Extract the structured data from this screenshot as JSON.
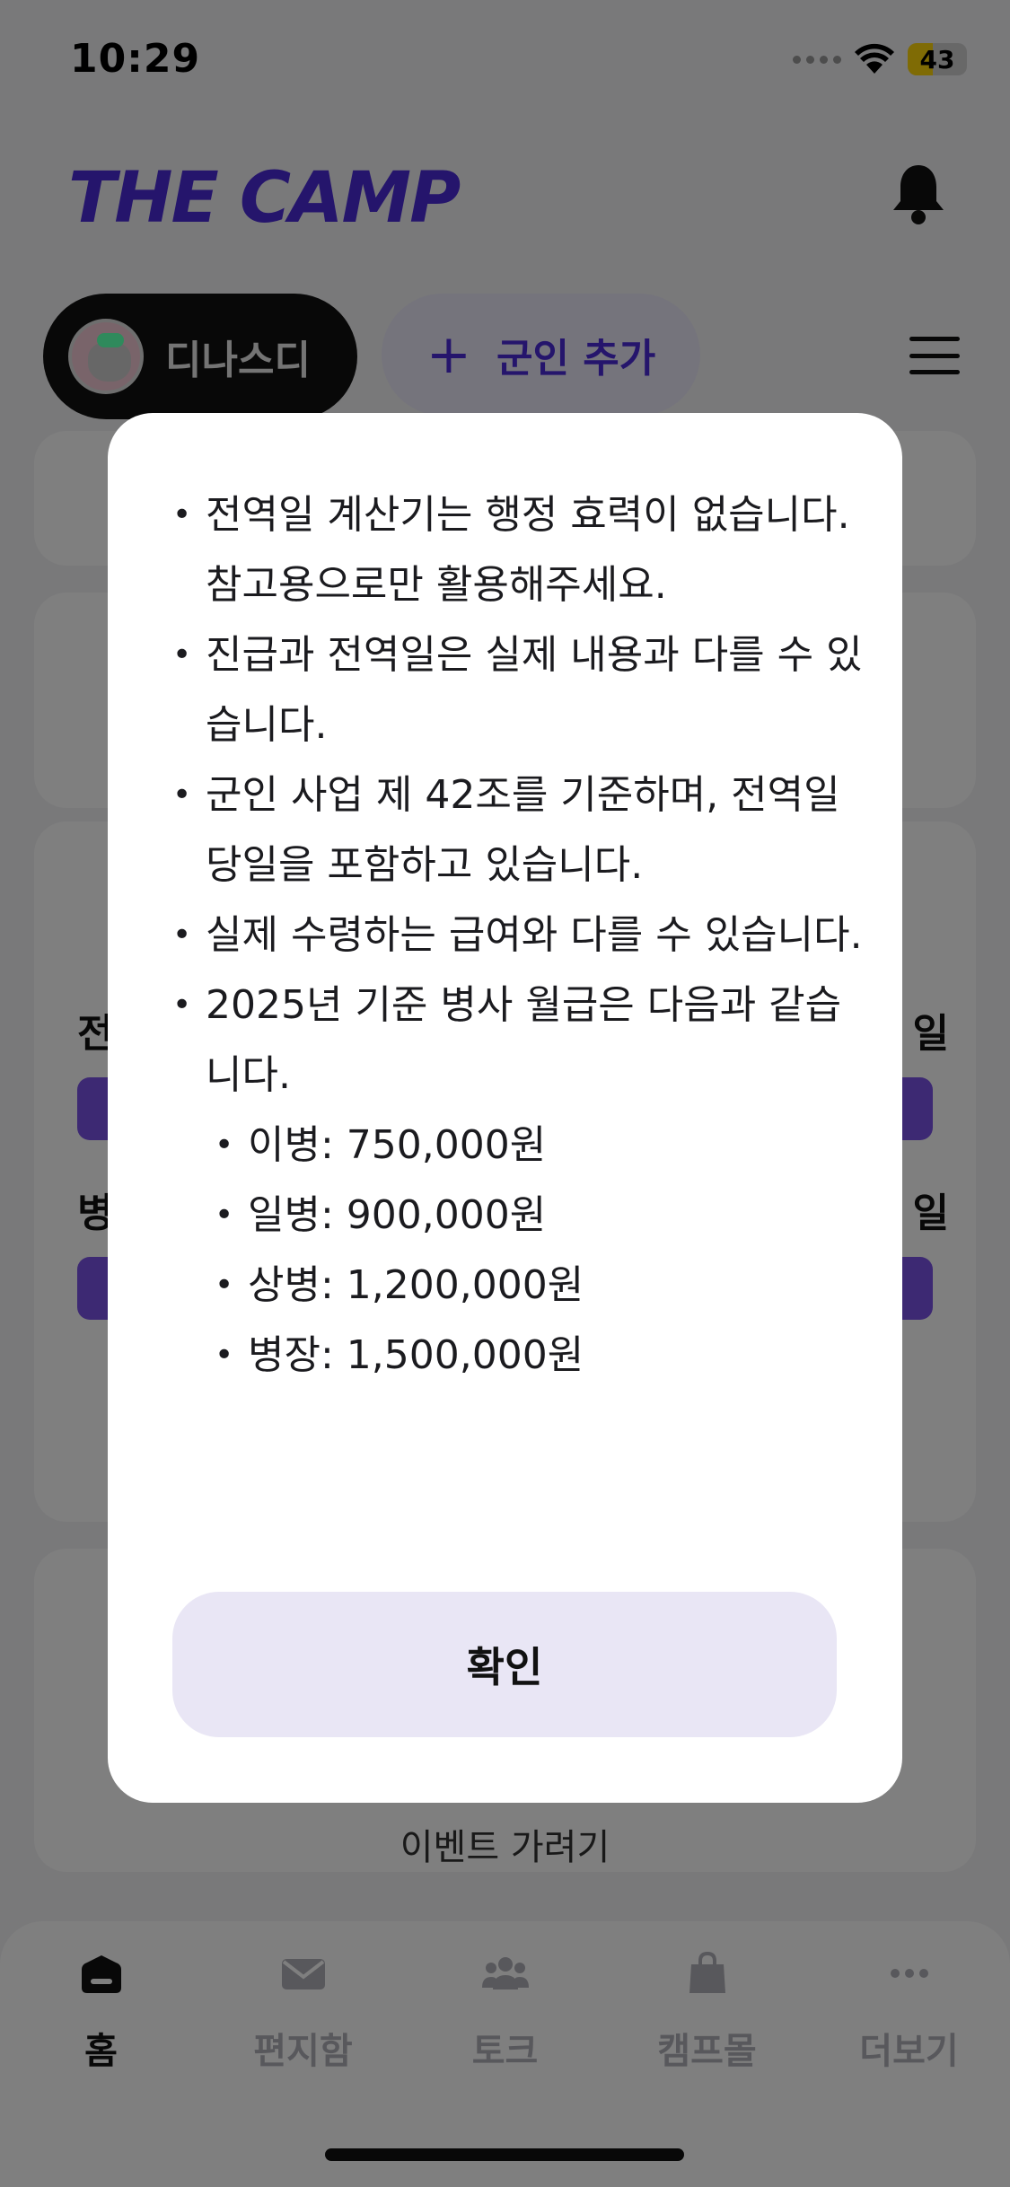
{
  "status_bar": {
    "time": "10:29",
    "battery": "43",
    "battery_level": 0.43
  },
  "header": {
    "logo": "THE CAMP",
    "bell_icon": "bell-icon"
  },
  "profile": {
    "name": "디나스디",
    "add_label": "군인 추가",
    "menu_icon": "hamburger-menu-icon"
  },
  "background_cards": {
    "row1_left": "전",
    "row1_right": "일",
    "row2_left": "병",
    "row2_right": "일",
    "card4_text": "이벤트 가려기"
  },
  "modal": {
    "notices": [
      {
        "text": "전역일 계산기는 행정 효력이 없습니다.",
        "sub_text": "참고용으로만 활용해주세요."
      },
      {
        "text": "진급과 전역일은 실제 내용과 다를 수 있습니다."
      },
      {
        "text": "군인 사업 제 42조를 기준하며, 전역일 당일을 포함하고 있습니다."
      },
      {
        "text": "실제 수령하는 급여와 다를 수 있습니다."
      },
      {
        "text": "2025년 기준 병사 월급은 다음과 같습니다."
      }
    ],
    "salaries": [
      "이병: 750,000원",
      "일병: 900,000원",
      "상병: 1,200,000원",
      "병장: 1,500,000원"
    ],
    "confirm_label": "확인"
  },
  "tab_bar": {
    "tabs": [
      {
        "label": "홈",
        "icon": "home-icon"
      },
      {
        "label": "편지함",
        "icon": "mail-icon"
      },
      {
        "label": "토크",
        "icon": "people-icon"
      },
      {
        "label": "캠프몰",
        "icon": "shopping-bag-icon"
      },
      {
        "label": "더보기",
        "icon": "more-icon"
      }
    ]
  }
}
